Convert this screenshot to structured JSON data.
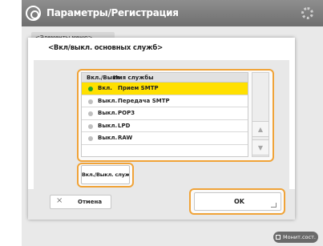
{
  "window": {
    "title": "Параметры/Регистрация"
  },
  "background": {
    "back_button_label": "<Элементы меню>"
  },
  "dialog": {
    "title": "<Вкл/выкл. основных служб>",
    "list": {
      "headers": [
        "Вкл./Выкл.",
        "Имя службы"
      ],
      "rows": [
        {
          "status": "Вкл.",
          "name": "Прием SMTP",
          "selected": true
        },
        {
          "status": "Выкл.",
          "name": "Передача SMTP",
          "selected": false
        },
        {
          "status": "Выкл.",
          "name": "POP3",
          "selected": false
        },
        {
          "status": "Выкл.",
          "name": "LPD",
          "selected": false
        },
        {
          "status": "Выкл.",
          "name": "RAW",
          "selected": false
        }
      ]
    },
    "scroll": {
      "up_icon": "▲",
      "down_icon": "▼"
    },
    "toggle_button_label": "Вкл./Выкл. службы",
    "cancel_label": "Отмена",
    "cancel_icon": "×",
    "ok_label": "OK"
  },
  "statusbar": {
    "label": "Монит.сост."
  },
  "colors": {
    "highlight": "#f0a338",
    "selected_row": "#ffe000",
    "active_dot": "#2aa52a"
  }
}
